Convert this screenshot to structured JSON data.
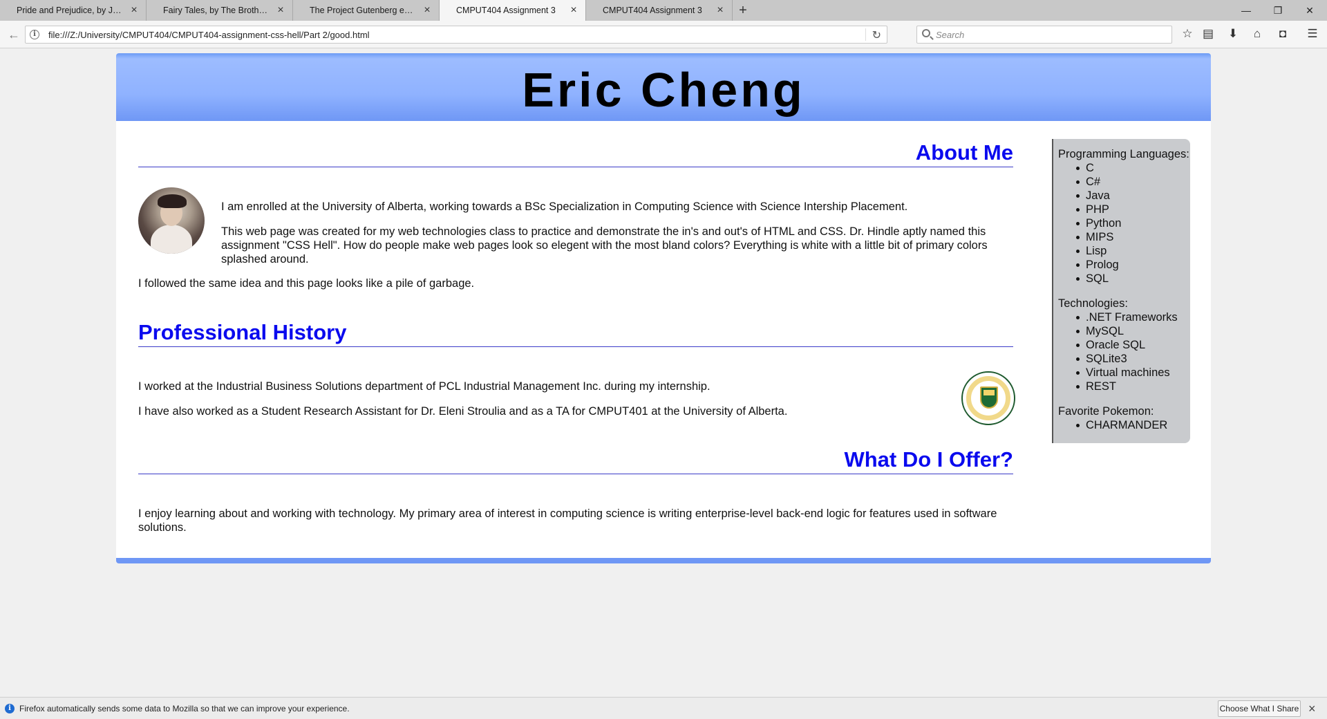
{
  "browser": {
    "tabs": [
      {
        "title": "Pride and Prejudice, by Jane A..."
      },
      {
        "title": "Fairy Tales, by The Brothers Gr..."
      },
      {
        "title": "The Project Gutenberg eBook ..."
      },
      {
        "title": "CMPUT404 Assignment 3",
        "active": true
      },
      {
        "title": "CMPUT404 Assignment 3"
      }
    ],
    "new_tab": "+",
    "url": "file:///Z:/University/CMPUT404/CMPUT404-assignment-css-hell/Part 2/good.html",
    "search_placeholder": "Search"
  },
  "page": {
    "header_title": "Eric Cheng",
    "about": {
      "heading": "About Me",
      "p1": "I am enrolled at the University of Alberta, working towards a BSc Specialization in Computing Science with Science Intership Placement.",
      "p2": "This web page was created for my web technologies class to practice and demonstrate the in's and out's of HTML and CSS. Dr. Hindle aptly named this assignment \"CSS Hell\". How do people make web pages look so elegent with the most bland colors? Everything is white with a little bit of primary colors splashed around.",
      "p3": "I followed the same idea and this page looks like a pile of garbage."
    },
    "history": {
      "heading": "Professional History",
      "p1": "I worked at the Industrial Business Solutions department of PCL Industrial Management Inc. during my internship.",
      "p2": "I have also worked as a Student Research Assistant for Dr. Eleni Stroulia and as a TA for CMPUT401 at the University of Alberta."
    },
    "offer": {
      "heading": "What Do I Offer?",
      "p1": "I enjoy learning about and working with technology. My primary area of interest in computing science is writing enterprise-level back-end logic for features used in software solutions."
    },
    "sidebar": {
      "languages_label": "Programming Languages:",
      "languages": [
        "C",
        "C#",
        "Java",
        "PHP",
        "Python",
        "MIPS",
        "Lisp",
        "Prolog",
        "SQL"
      ],
      "technologies_label": "Technologies:",
      "technologies": [
        ".NET Frameworks",
        "MySQL",
        "Oracle SQL",
        "SQLite3",
        "Virtual machines",
        "REST"
      ],
      "pokemon_label": "Favorite Pokemon:",
      "pokemon": [
        "CHARMANDER"
      ]
    }
  },
  "notification": {
    "text": "Firefox automatically sends some data to Mozilla so that we can improve your experience.",
    "button": "Choose What I Share"
  },
  "colors": {
    "header_blue": "#8fb2ff",
    "heading_blue": "#0a0aee",
    "sidebar_gray": "#c9cbce"
  }
}
